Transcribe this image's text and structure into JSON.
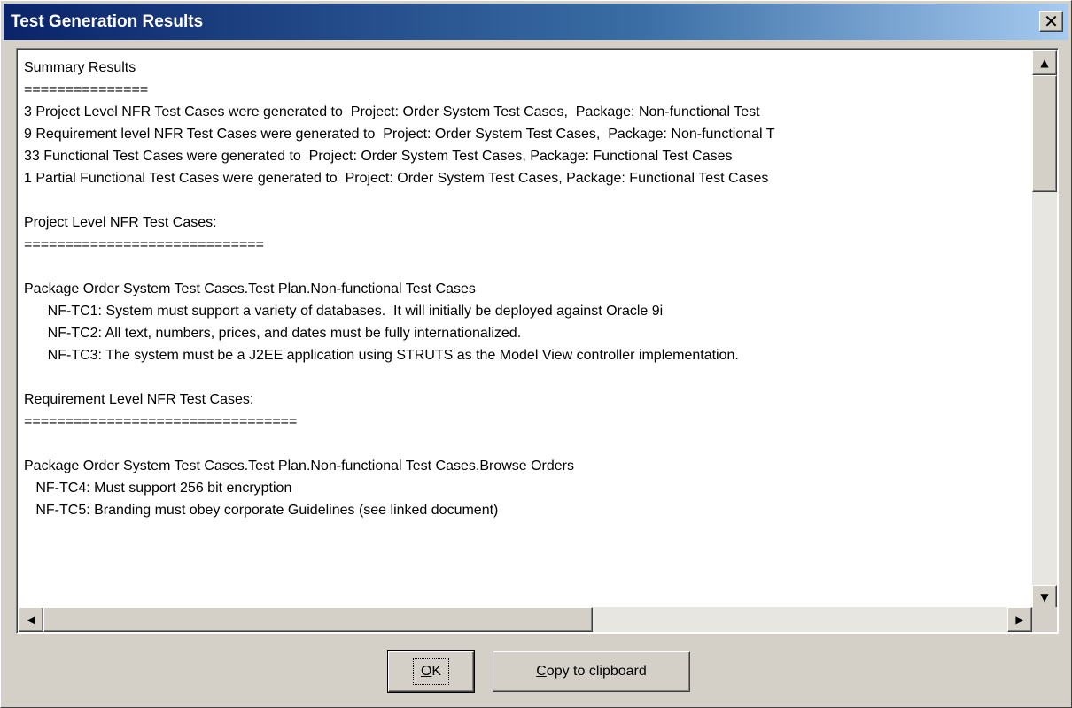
{
  "window": {
    "title": "Test Generation Results",
    "close_glyph": "✕"
  },
  "report": {
    "lines": [
      "Summary Results",
      "===============",
      "3 Project Level NFR Test Cases were generated to  Project: Order System Test Cases,  Package: Non-functional Test",
      "9 Requirement level NFR Test Cases were generated to  Project: Order System Test Cases,  Package: Non-functional T",
      "33 Functional Test Cases were generated to  Project: Order System Test Cases, Package: Functional Test Cases",
      "1 Partial Functional Test Cases were generated to  Project: Order System Test Cases, Package: Functional Test Cases",
      "",
      "Project Level NFR Test Cases:",
      "=============================",
      "",
      "Package Order System Test Cases.Test Plan.Non-functional Test Cases",
      "      NF-TC1: System must support a variety of databases.  It will initially be deployed against Oracle 9i",
      "      NF-TC2: All text, numbers, prices, and dates must be fully internationalized.",
      "      NF-TC3: The system must be a J2EE application using STRUTS as the Model View controller implementation.",
      "",
      "Requirement Level NFR Test Cases:",
      "=================================",
      "",
      "Package Order System Test Cases.Test Plan.Non-functional Test Cases.Browse Orders",
      "   NF-TC4: Must support 256 bit encryption",
      "   NF-TC5: Branding must obey corporate Guidelines (see linked document)"
    ]
  },
  "scrollbars": {
    "up_glyph": "▲",
    "down_glyph": "▼",
    "left_glyph": "◀",
    "right_glyph": "▶",
    "vertical_position": 0,
    "horizontal_position": 0
  },
  "buttons": {
    "ok_label_access": "O",
    "ok_label_rest": "K",
    "copy_label_access": "C",
    "copy_label_rest": "opy to clipboard"
  }
}
